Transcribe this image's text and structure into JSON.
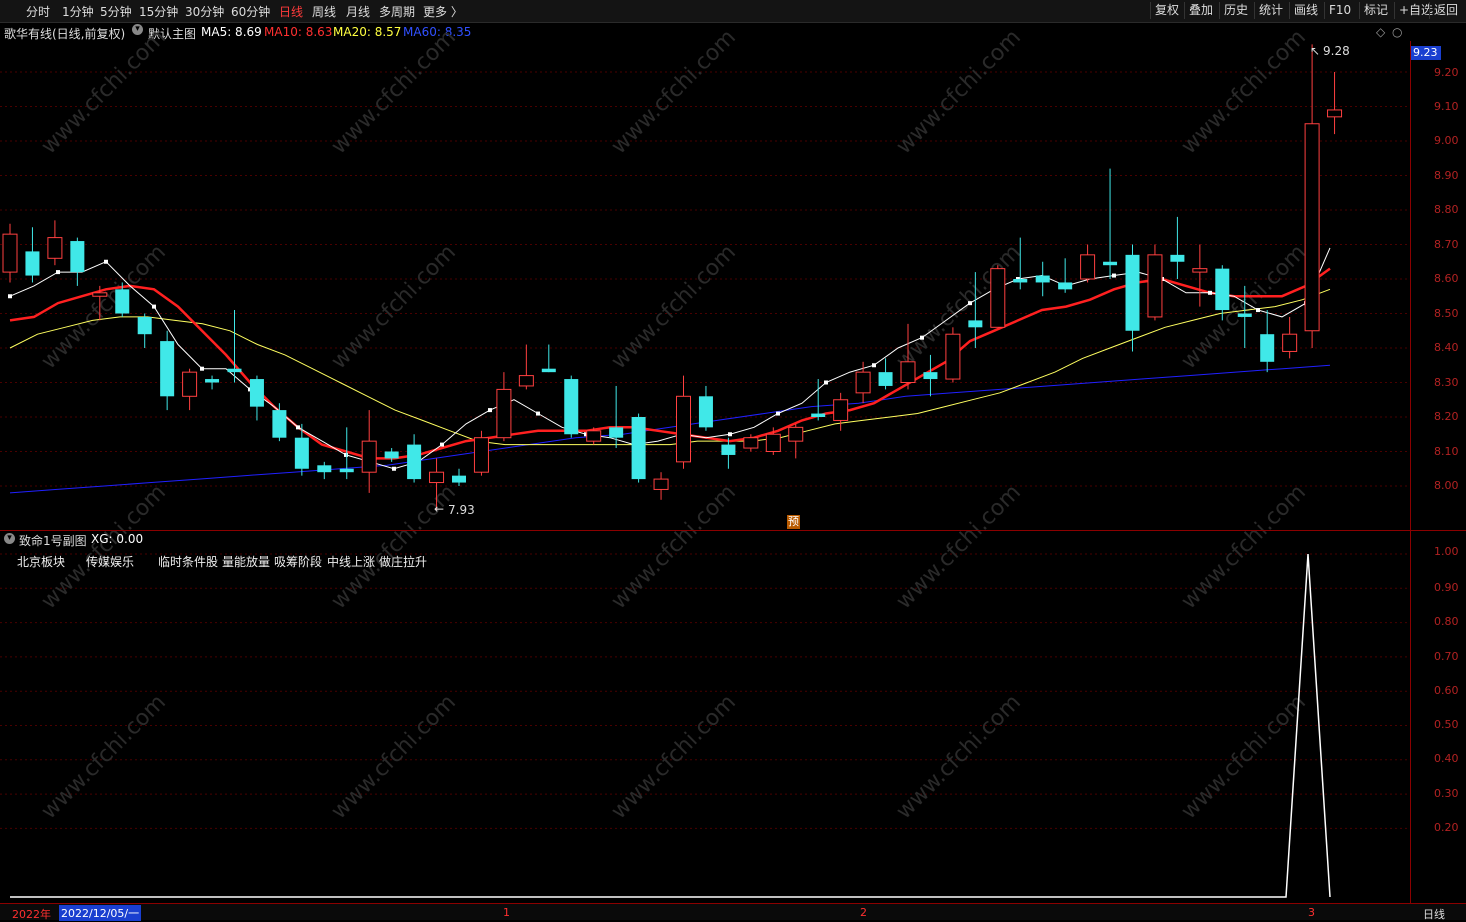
{
  "toolbar": {
    "periods": [
      "分时",
      "1分钟",
      "5分钟",
      "15分钟",
      "30分钟",
      "60分钟",
      "日线",
      "周线",
      "月线",
      "多周期",
      "更多 〉"
    ],
    "active_period": "日线",
    "right_buttons": [
      "复权",
      "叠加",
      "历史",
      "统计",
      "画线",
      "F10",
      "标记",
      "+自选",
      "返回"
    ]
  },
  "main": {
    "stock_title": "歌华有线(日线,前复权)",
    "indicator_name": "默认主图",
    "ma5": "MA5: 8.69",
    "ma10": "MA10: 8.63",
    "ma20": "MA20: 8.57",
    "ma60": "MA60: 8.35",
    "last_price": "9.23",
    "high_label": "9.28",
    "low_label": "7.93",
    "marker": "预",
    "y_ticks": [
      "9.20",
      "9.10",
      "9.00",
      "8.90",
      "8.80",
      "8.70",
      "8.60",
      "8.50",
      "8.40",
      "8.30",
      "8.20",
      "8.10",
      "8.00"
    ],
    "colors": {
      "ma5": "#ffffff",
      "ma10": "#ff2020",
      "ma20": "#ffff60",
      "ma60": "#2020ff",
      "up": "#ff4040",
      "down": "#40e8e8"
    }
  },
  "sub": {
    "title": "致命1号副图",
    "xg": "XG: 0.00",
    "tags": [
      "北京板块",
      "传媒娱乐",
      "临时条件股",
      "量能放量",
      "吸筹阶段",
      "中线上涨",
      "做庄拉升"
    ],
    "y_ticks": [
      "1.00",
      "0.90",
      "0.80",
      "0.70",
      "0.60",
      "0.50",
      "0.40",
      "0.30",
      "0.20"
    ]
  },
  "bottom": {
    "year": "2022年",
    "date": "2022/12/05/一",
    "month_marks": [
      "1",
      "2",
      "3"
    ],
    "period_label": "日线"
  },
  "chart_data": {
    "type": "candlestick",
    "candles": [
      {
        "o": 8.62,
        "c": 8.73,
        "h": 8.76,
        "l": 8.59
      },
      {
        "o": 8.68,
        "c": 8.61,
        "h": 8.75,
        "l": 8.59
      },
      {
        "o": 8.66,
        "c": 8.72,
        "h": 8.77,
        "l": 8.64
      },
      {
        "o": 8.71,
        "c": 8.62,
        "h": 8.72,
        "l": 8.58
      },
      {
        "o": 8.55,
        "c": 8.56,
        "h": 8.58,
        "l": 8.48
      },
      {
        "o": 8.57,
        "c": 8.5,
        "h": 8.59,
        "l": 8.49
      },
      {
        "o": 8.49,
        "c": 8.44,
        "h": 8.5,
        "l": 8.4
      },
      {
        "o": 8.42,
        "c": 8.26,
        "h": 8.45,
        "l": 8.22
      },
      {
        "o": 8.26,
        "c": 8.33,
        "h": 8.34,
        "l": 8.22
      },
      {
        "o": 8.31,
        "c": 8.3,
        "h": 8.32,
        "l": 8.28
      },
      {
        "o": 8.34,
        "c": 8.33,
        "h": 8.51,
        "l": 8.3
      },
      {
        "o": 8.31,
        "c": 8.23,
        "h": 8.32,
        "l": 8.19
      },
      {
        "o": 8.22,
        "c": 8.14,
        "h": 8.24,
        "l": 8.13
      },
      {
        "o": 8.14,
        "c": 8.05,
        "h": 8.18,
        "l": 8.03
      },
      {
        "o": 8.06,
        "c": 8.04,
        "h": 8.07,
        "l": 8.02
      },
      {
        "o": 8.05,
        "c": 8.04,
        "h": 8.17,
        "l": 8.02
      },
      {
        "o": 8.04,
        "c": 8.13,
        "h": 8.22,
        "l": 7.98
      },
      {
        "o": 8.1,
        "c": 8.08,
        "h": 8.11,
        "l": 8.07
      },
      {
        "o": 8.12,
        "c": 8.02,
        "h": 8.15,
        "l": 8.01
      },
      {
        "o": 8.01,
        "c": 8.04,
        "h": 8.08,
        "l": 7.93
      },
      {
        "o": 8.03,
        "c": 8.01,
        "h": 8.05,
        "l": 8.0
      },
      {
        "o": 8.04,
        "c": 8.14,
        "h": 8.16,
        "l": 8.03
      },
      {
        "o": 8.14,
        "c": 8.28,
        "h": 8.33,
        "l": 8.13
      },
      {
        "o": 8.29,
        "c": 8.32,
        "h": 8.41,
        "l": 8.28
      },
      {
        "o": 8.34,
        "c": 8.33,
        "h": 8.41,
        "l": 8.33
      },
      {
        "o": 8.31,
        "c": 8.15,
        "h": 8.32,
        "l": 8.14
      },
      {
        "o": 8.13,
        "c": 8.16,
        "h": 8.17,
        "l": 8.12
      },
      {
        "o": 8.17,
        "c": 8.14,
        "h": 8.29,
        "l": 8.11
      },
      {
        "o": 8.2,
        "c": 8.02,
        "h": 8.21,
        "l": 8.01
      },
      {
        "o": 7.99,
        "c": 8.02,
        "h": 8.04,
        "l": 7.96
      },
      {
        "o": 8.07,
        "c": 8.26,
        "h": 8.32,
        "l": 8.05
      },
      {
        "o": 8.26,
        "c": 8.17,
        "h": 8.29,
        "l": 8.16
      },
      {
        "o": 8.12,
        "c": 8.09,
        "h": 8.14,
        "l": 8.05
      },
      {
        "o": 8.11,
        "c": 8.14,
        "h": 8.15,
        "l": 8.1
      },
      {
        "o": 8.1,
        "c": 8.15,
        "h": 8.17,
        "l": 8.09
      },
      {
        "o": 8.13,
        "c": 8.17,
        "h": 8.18,
        "l": 8.08
      },
      {
        "o": 8.21,
        "c": 8.2,
        "h": 8.31,
        "l": 8.19
      },
      {
        "o": 8.19,
        "c": 8.25,
        "h": 8.27,
        "l": 8.16
      },
      {
        "o": 8.27,
        "c": 8.33,
        "h": 8.36,
        "l": 8.24
      },
      {
        "o": 8.33,
        "c": 8.29,
        "h": 8.37,
        "l": 8.28
      },
      {
        "o": 8.3,
        "c": 8.36,
        "h": 8.47,
        "l": 8.28
      },
      {
        "o": 8.33,
        "c": 8.31,
        "h": 8.38,
        "l": 8.26
      },
      {
        "o": 8.31,
        "c": 8.44,
        "h": 8.46,
        "l": 8.3
      },
      {
        "o": 8.48,
        "c": 8.46,
        "h": 8.62,
        "l": 8.4
      },
      {
        "o": 8.46,
        "c": 8.63,
        "h": 8.64,
        "l": 8.46
      },
      {
        "o": 8.6,
        "c": 8.59,
        "h": 8.72,
        "l": 8.57
      },
      {
        "o": 8.61,
        "c": 8.59,
        "h": 8.65,
        "l": 8.55
      },
      {
        "o": 8.59,
        "c": 8.57,
        "h": 8.66,
        "l": 8.56
      },
      {
        "o": 8.6,
        "c": 8.67,
        "h": 8.7,
        "l": 8.59
      },
      {
        "o": 8.65,
        "c": 8.64,
        "h": 8.92,
        "l": 8.6
      },
      {
        "o": 8.67,
        "c": 8.45,
        "h": 8.7,
        "l": 8.39
      },
      {
        "o": 8.49,
        "c": 8.67,
        "h": 8.7,
        "l": 8.48
      },
      {
        "o": 8.67,
        "c": 8.65,
        "h": 8.78,
        "l": 8.6
      },
      {
        "o": 8.62,
        "c": 8.63,
        "h": 8.7,
        "l": 8.52
      },
      {
        "o": 8.63,
        "c": 8.51,
        "h": 8.64,
        "l": 8.48
      },
      {
        "o": 8.5,
        "c": 8.49,
        "h": 8.58,
        "l": 8.4
      },
      {
        "o": 8.44,
        "c": 8.36,
        "h": 8.51,
        "l": 8.33
      },
      {
        "o": 8.39,
        "c": 8.44,
        "h": 8.49,
        "l": 8.37
      },
      {
        "o": 8.45,
        "c": 9.05,
        "h": 9.28,
        "l": 8.4
      },
      {
        "o": 9.07,
        "c": 9.09,
        "h": 9.2,
        "l": 9.02
      }
    ],
    "ma5": [
      8.55,
      8.58,
      8.62,
      8.62,
      8.65,
      8.58,
      8.52,
      8.41,
      8.34,
      8.34,
      8.28,
      8.23,
      8.17,
      8.13,
      8.09,
      8.07,
      8.05,
      8.07,
      8.12,
      8.18,
      8.22,
      8.25,
      8.21,
      8.17,
      8.15,
      8.14,
      8.12,
      8.13,
      8.15,
      8.14,
      8.15,
      8.17,
      8.21,
      8.24,
      8.3,
      8.33,
      8.35,
      8.4,
      8.43,
      8.48,
      8.53,
      8.57,
      8.6,
      8.61,
      8.58,
      8.6,
      8.61,
      8.62,
      8.6,
      8.56,
      8.56,
      8.55,
      8.51,
      8.49,
      8.53,
      8.69
    ],
    "ma10": [
      8.48,
      8.49,
      8.53,
      8.55,
      8.57,
      8.58,
      8.57,
      8.52,
      8.45,
      8.38,
      8.3,
      8.23,
      8.17,
      8.12,
      8.1,
      8.08,
      8.08,
      8.09,
      8.11,
      8.13,
      8.14,
      8.15,
      8.16,
      8.16,
      8.16,
      8.17,
      8.17,
      8.16,
      8.15,
      8.14,
      8.13,
      8.14,
      8.16,
      8.19,
      8.21,
      8.22,
      8.24,
      8.28,
      8.32,
      8.36,
      8.42,
      8.45,
      8.48,
      8.51,
      8.52,
      8.54,
      8.57,
      8.59,
      8.6,
      8.58,
      8.56,
      8.55,
      8.55,
      8.55,
      8.58,
      8.63
    ],
    "ma20": [
      8.4,
      8.44,
      8.46,
      8.48,
      8.49,
      8.49,
      8.48,
      8.47,
      8.45,
      8.41,
      8.38,
      8.34,
      8.3,
      8.26,
      8.22,
      8.19,
      8.16,
      8.13,
      8.12,
      8.12,
      8.12,
      8.12,
      8.12,
      8.12,
      8.12,
      8.13,
      8.13,
      8.13,
      8.14,
      8.16,
      8.18,
      8.19,
      8.2,
      8.21,
      8.23,
      8.25,
      8.27,
      8.3,
      8.33,
      8.37,
      8.4,
      8.43,
      8.46,
      8.48,
      8.5,
      8.51,
      8.52,
      8.54,
      8.57
    ],
    "ma60": [
      7.98,
      7.99,
      8.0,
      8.01,
      8.02,
      8.03,
      8.04,
      8.05,
      8.06,
      8.08,
      8.1,
      8.12,
      8.14,
      8.15,
      8.17,
      8.19,
      8.21,
      8.23,
      8.24,
      8.26,
      8.27,
      8.28,
      8.29,
      8.3,
      8.31,
      8.32,
      8.33,
      8.34,
      8.35
    ],
    "sub_series": {
      "name": "XG",
      "values_note": "flat 0 then spike to 1.00 at second-to-last bar",
      "values": [
        0,
        0,
        0,
        1,
        0
      ]
    }
  }
}
